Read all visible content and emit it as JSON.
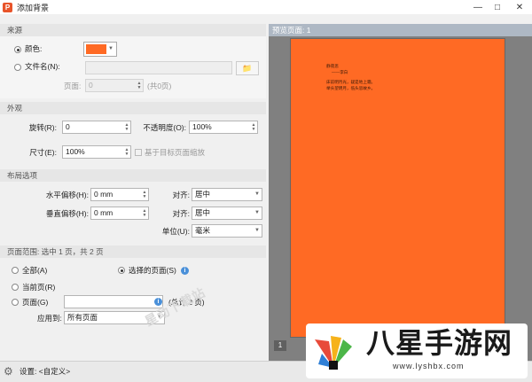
{
  "window": {
    "title": "添加背景",
    "app_icon": "P"
  },
  "source": {
    "header": "来源",
    "color_label": "颜色:",
    "color_value": "#ff6a24",
    "file_label": "文件名(N):",
    "file_value": "",
    "page_label": "页面:",
    "page_value": "0",
    "page_total": "(共0页)"
  },
  "appearance": {
    "header": "外观",
    "rotate_label": "旋转(R):",
    "rotate_value": "0",
    "opacity_label": "不透明度(O):",
    "opacity_value": "100%",
    "size_label": "尺寸(E):",
    "size_value": "100%",
    "scale_label": "基于目标页面缩放"
  },
  "layout": {
    "header": "布局选项",
    "hoffset_label": "水平偏移(H):",
    "hoffset_value": "0 mm",
    "voffset_label": "垂直偏移(H):",
    "voffset_value": "0 mm",
    "halign_label": "对齐:",
    "halign_value": "居中",
    "valign_label": "对齐:",
    "valign_value": "居中",
    "unit_label": "单位(U):",
    "unit_value": "毫米"
  },
  "range": {
    "header": "页面范围: 选中 1 页，共 2 页",
    "all_label": "全部(A)",
    "selected_label": "选择的页面(S)",
    "current_label": "当前页(R)",
    "pages_label": "页面(G)",
    "pages_value": "",
    "pages_total": "(总计 2 页)",
    "apply_label": "应用到:",
    "apply_value": "所有页面"
  },
  "watermark_text": "星动下载站",
  "settings": {
    "label": "设置:",
    "value": "<自定义>"
  },
  "preview": {
    "header": "预览页面: 1",
    "page_number": "1",
    "page_color": "#ff6a24",
    "page_lines": [
      "静夜思",
      "——李白",
      "床前明月光，疑是地上霜。",
      "举头望明月，低头思故乡。"
    ]
  },
  "logo": {
    "text": "八星手游网",
    "url": "www.lyshbx.com"
  }
}
